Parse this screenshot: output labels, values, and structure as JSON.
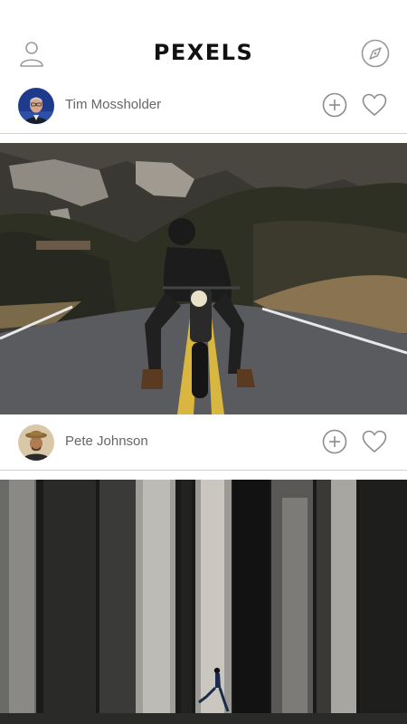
{
  "header": {
    "brand": "PEXELS",
    "profile_icon": "user-icon",
    "explore_icon": "compass-icon"
  },
  "feed": [
    {
      "author": "Tim Mossholder",
      "photo": "motorcycle-rider-road"
    },
    {
      "author": "Pete Johnson",
      "photo": "marble-hall-runner"
    }
  ],
  "actions": {
    "collect_icon": "plus-circle-icon",
    "like_icon": "heart-icon"
  },
  "colors": {
    "icon_gray": "#8c8c8c",
    "text_gray": "#666666",
    "brand_black": "#111111"
  }
}
